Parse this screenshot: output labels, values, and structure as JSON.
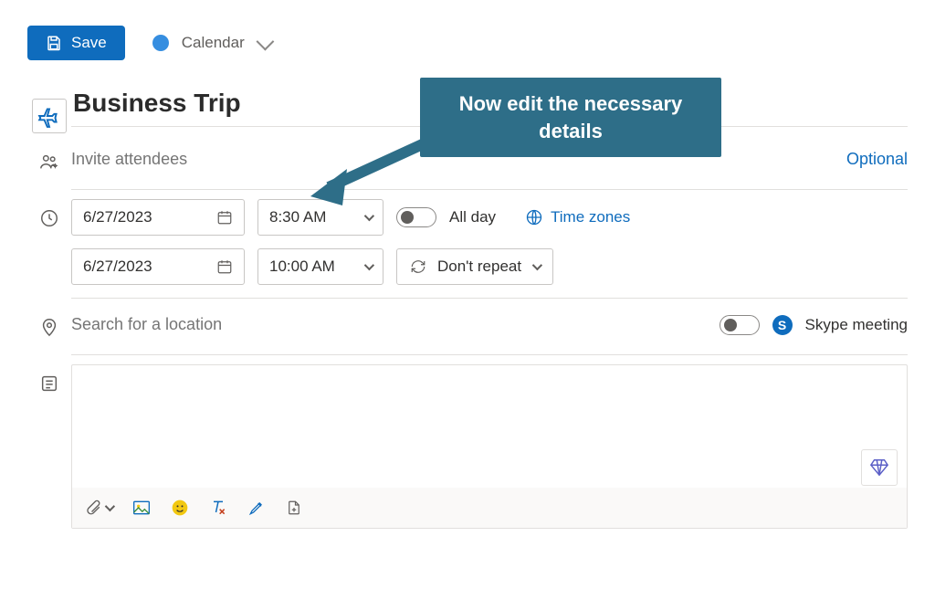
{
  "toolbar": {
    "save_label": "Save",
    "calendar_label": "Calendar"
  },
  "event": {
    "title_value": "Business Trip",
    "attendees_placeholder": "Invite attendees",
    "optional_label": "Optional",
    "start_date": "6/27/2023",
    "start_time": "8:30 AM",
    "end_date": "6/27/2023",
    "end_time": "10:00 AM",
    "all_day_label": "All day",
    "time_zones_label": "Time zones",
    "repeat_label": "Don't repeat",
    "location_placeholder": "Search for a location",
    "skype_label": "Skype meeting"
  },
  "annotation": {
    "text": "Now edit the necessary details"
  }
}
